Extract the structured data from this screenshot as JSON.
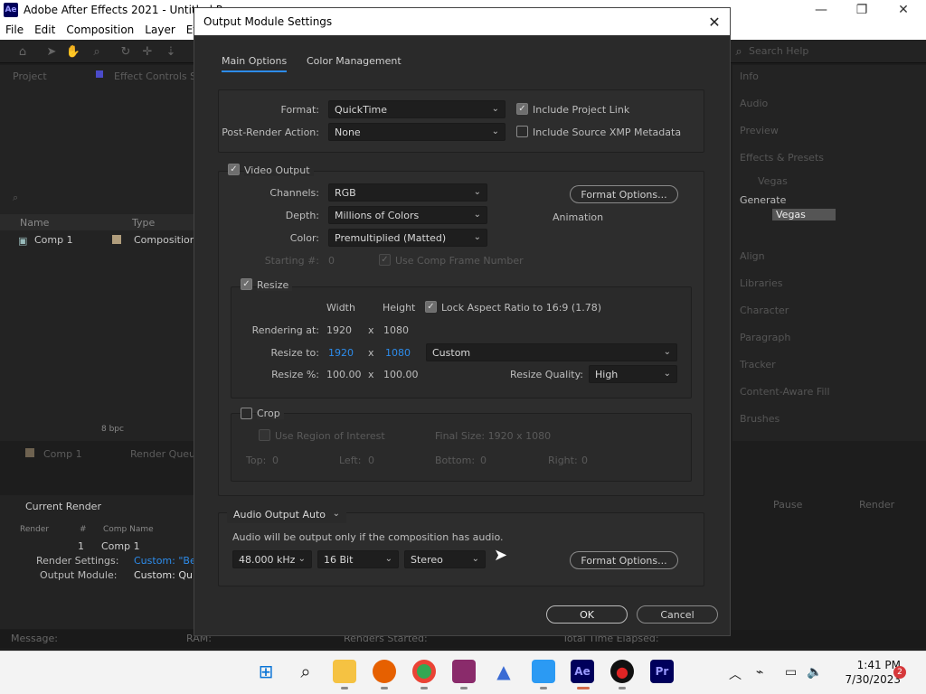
{
  "app": {
    "title": "Adobe After Effects 2021 - Untitled P",
    "logo": "Ae",
    "menu": [
      "File",
      "Edit",
      "Composition",
      "Layer",
      "Effe"
    ],
    "window_controls": [
      "—",
      "❐",
      "✕"
    ],
    "search_help": "Search Help"
  },
  "project_panel": {
    "tab": "Project",
    "effect_controls_tab": "Effect Controls Sh",
    "columns": {
      "name": "Name",
      "type": "Type"
    },
    "item": {
      "name": "Comp 1",
      "type": "Composition"
    },
    "bpc": "8 bpc"
  },
  "timeline_tabs": {
    "comp": "Comp 1",
    "render_queue": "Render Queue"
  },
  "render_queue": {
    "current_render": "Current Render",
    "columns": {
      "render": "Render",
      "num": "#",
      "comp": "Comp Name"
    },
    "row": {
      "num": "1",
      "comp": "Comp 1"
    },
    "render_settings_label": "Render Settings:",
    "render_settings_value": "Custom: \"Best S",
    "output_module_label": "Output Module:",
    "output_module_value": "Custom: Quick",
    "pause": "Pause",
    "render": "Render"
  },
  "status_bar": {
    "message": "Message:",
    "ram": "RAM:",
    "renders_started": "Renders Started:",
    "total_time": "Total Time Elapsed:"
  },
  "right_panel": {
    "items": [
      "Info",
      "Audio",
      "Preview",
      "Effects & Presets"
    ],
    "search_value": "Vegas",
    "generate": "Generate",
    "vegas": "Vegas",
    "items2": [
      "Align",
      "Libraries",
      "Character",
      "Paragraph",
      "Tracker",
      "Content-Aware Fill",
      "Brushes"
    ]
  },
  "dialog": {
    "title": "Output Module Settings",
    "tabs": [
      "Main Options",
      "Color Management"
    ],
    "format_label": "Format:",
    "format_value": "QuickTime",
    "post_render_label": "Post-Render Action:",
    "post_render_value": "None",
    "include_project_link": "Include Project Link",
    "include_xmp": "Include Source XMP Metadata",
    "video_output": "Video Output",
    "channels_label": "Channels:",
    "channels_value": "RGB",
    "depth_label": "Depth:",
    "depth_value": "Millions of Colors",
    "color_label": "Color:",
    "color_value": "Premultiplied (Matted)",
    "starting_label": "Starting #:",
    "starting_value": "0",
    "use_comp_frame": "Use Comp Frame Number",
    "format_options": "Format Options...",
    "codec": "Animation",
    "resize": "Resize",
    "width": "Width",
    "height": "Height",
    "lock_aspect": "Lock Aspect Ratio to 16:9 (1.78)",
    "rendering_at_label": "Rendering at:",
    "rendering_w": "1920",
    "rendering_h": "1080",
    "x": "x",
    "resize_to_label": "Resize to:",
    "resize_w": "1920",
    "resize_h": "1080",
    "resize_preset": "Custom",
    "resize_pct_label": "Resize %:",
    "pct_w": "100.00",
    "pct_h": "100.00",
    "resize_quality_label": "Resize Quality:",
    "resize_quality_value": "High",
    "crop": "Crop",
    "use_roi": "Use Region of Interest",
    "final_size": "Final Size: 1920 x 1080",
    "top_label": "Top:",
    "top_value": "0",
    "left_label": "Left:",
    "left_value": "0",
    "bottom_label": "Bottom:",
    "bottom_value": "0",
    "right_label": "Right:",
    "right_value": "0",
    "audio_output": "Audio Output Auto",
    "audio_note": "Audio will be output only if the composition has audio.",
    "sample_rate": "48.000 kHz",
    "bit_depth": "16 Bit",
    "channels_audio": "Stereo",
    "audio_format_options": "Format Options...",
    "ok": "OK",
    "cancel": "Cancel"
  },
  "taskbar": {
    "time": "1:41 PM",
    "date": "7/30/2023",
    "notifications": "2"
  }
}
